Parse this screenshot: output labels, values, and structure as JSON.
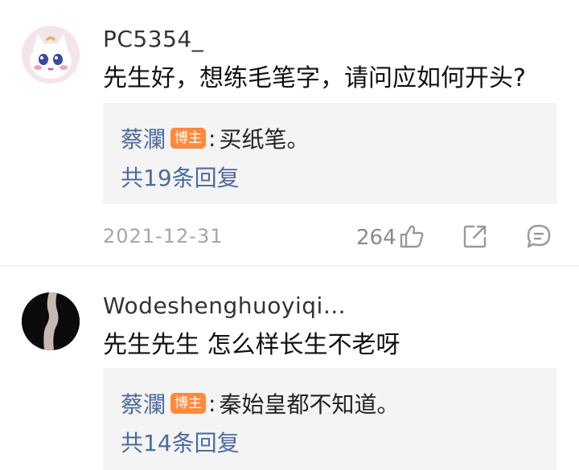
{
  "comments": [
    {
      "username": "PC5354_",
      "text": "先生好，想练毛笔字，请问应如何开头?",
      "reply": {
        "author": "蔡瀾",
        "badge": "博主",
        "separator": ":",
        "text": "买纸笔。",
        "count_label": "共19条回复"
      },
      "date": "2021-12-31",
      "likes": "264"
    },
    {
      "username": "Wodeshenghuoyiqi…",
      "text": "先生先生 怎么样长生不老呀",
      "reply": {
        "author": "蔡瀾",
        "badge": "博主",
        "separator": ":",
        "text": "秦始皇都不知道。",
        "count_label": "共14条回复"
      }
    }
  ],
  "icons": {
    "like": "thumbs-up-icon",
    "share": "share-icon",
    "comment": "comment-icon"
  }
}
